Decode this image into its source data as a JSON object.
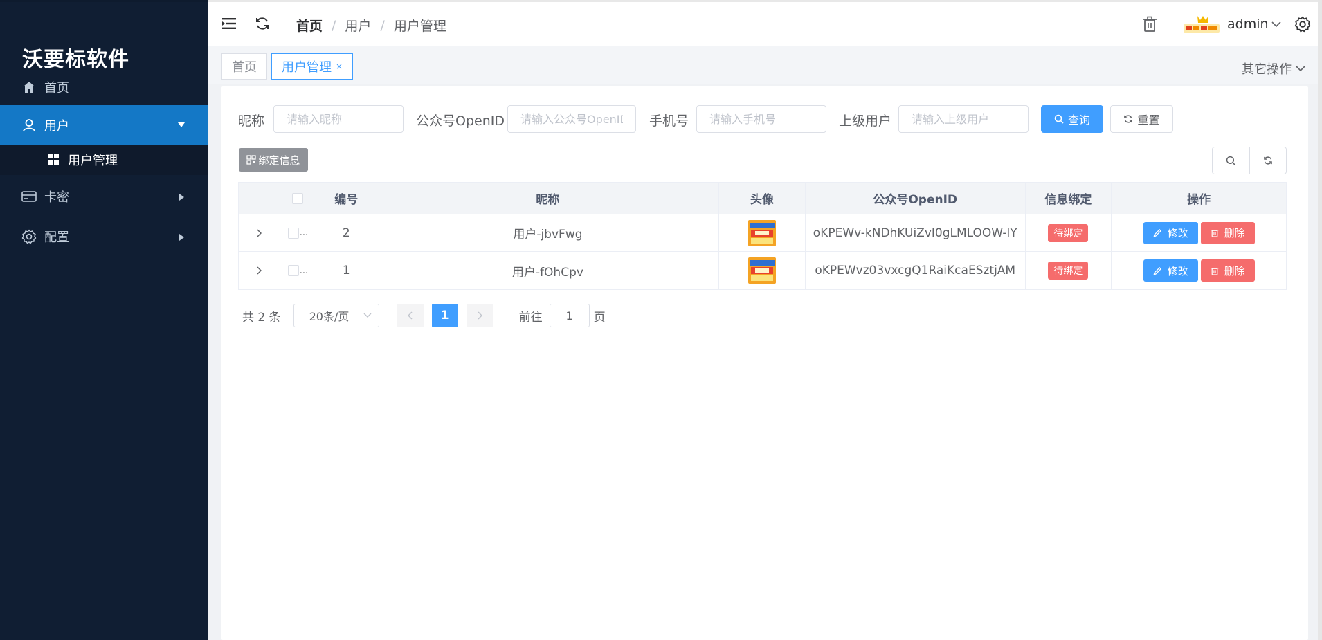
{
  "sidebar": {
    "brand": "沃要标软件",
    "items": [
      {
        "label": "首页",
        "icon": "home-icon"
      },
      {
        "label": "用户",
        "icon": "user-icon"
      },
      {
        "label": "卡密",
        "icon": "card-icon"
      },
      {
        "label": "配置",
        "icon": "gear-icon"
      }
    ],
    "submenu": [
      {
        "label": "用户管理",
        "icon": "grid-icon"
      }
    ],
    "active_color": "#1478c6",
    "bg_color": "#101e33"
  },
  "header": {
    "breadcrumb": [
      "首页",
      "用户",
      "用户管理"
    ],
    "username": "admin"
  },
  "tags": {
    "items": [
      {
        "label": "首页"
      },
      {
        "label": "用户管理",
        "close": "×"
      }
    ],
    "other_ops": "其它操作"
  },
  "search": {
    "fields": [
      {
        "label": "昵称",
        "placeholder": "请输入昵称"
      },
      {
        "label": "公众号OpenID",
        "placeholder": "请输入公众号OpenID"
      },
      {
        "label": "手机号",
        "placeholder": "请输入手机号"
      },
      {
        "label": "上级用户",
        "placeholder": "请输入上级用户"
      }
    ],
    "query_label": "查询",
    "reset_label": "重置"
  },
  "toolbar": {
    "bind_info_label": "绑定信息"
  },
  "table": {
    "headers": [
      "编号",
      "昵称",
      "头像",
      "公众号OpenID",
      "信息绑定",
      "操作"
    ],
    "rows": [
      {
        "id": "2",
        "nickname": "用户-jbvFwg",
        "openid": "oKPEWv-kNDhKUiZvI0gLMLOOW-lY",
        "bind_status": "待绑定"
      },
      {
        "id": "1",
        "nickname": "用户-fOhCpv",
        "openid": "oKPEWvz03vxcgQ1RaiKcaESztjAM",
        "bind_status": "待绑定"
      }
    ],
    "edit_label": "修改",
    "delete_label": "删除",
    "check_ellipsis": "..."
  },
  "pagination": {
    "total_text": "共 2 条",
    "page_size": "20条/页",
    "current_page": "1",
    "goto_prefix": "前往",
    "goto_value": "1",
    "goto_suffix": "页"
  }
}
